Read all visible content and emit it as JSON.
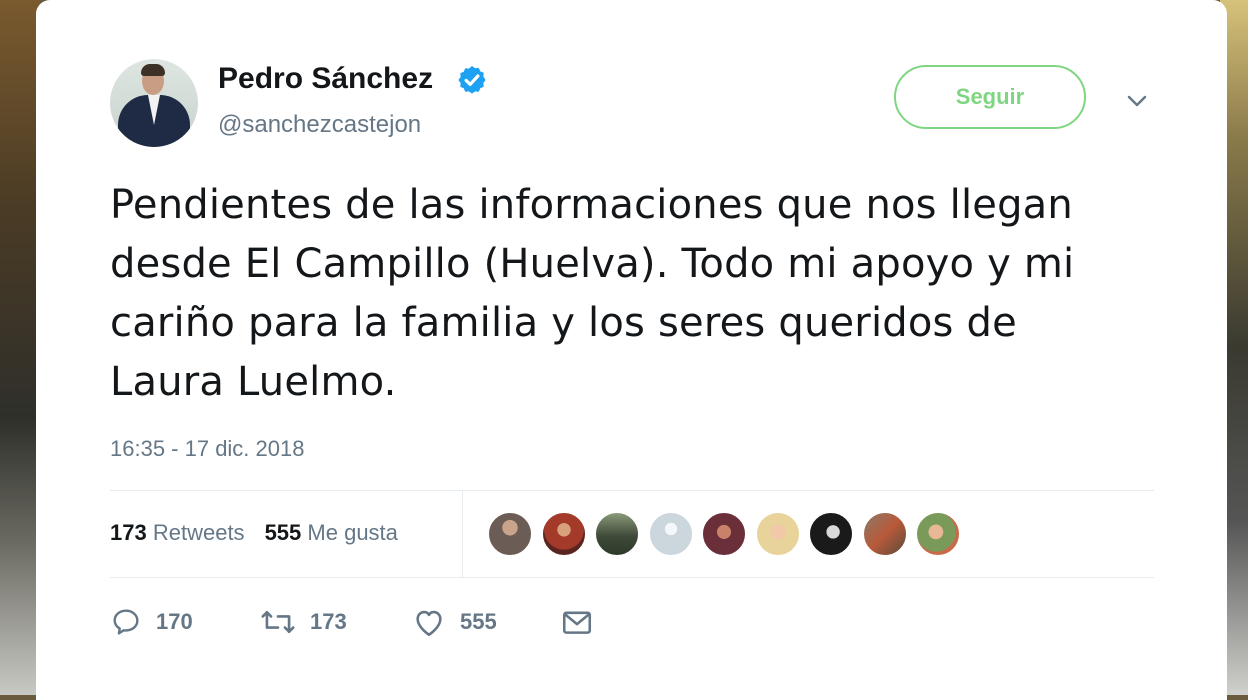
{
  "tweet": {
    "author_name": "Pedro Sánchez",
    "handle": "@sanchezcastejon",
    "verified_icon": "verified-badge-icon",
    "follow_label": "Seguir",
    "text": "Pendientes de las informaciones que nos llegan desde El Campillo (Huelva). Todo mi apoyo y mi cariño para la familia y los seres queridos de Laura Luelmo.",
    "timestamp": "16:35 - 17 dic. 2018"
  },
  "stats": {
    "retweets_count": "173",
    "retweets_label": "Retweets",
    "likes_count": "555",
    "likes_label": "Me gusta"
  },
  "likers_count_shown": 9,
  "actions": {
    "reply_icon": "reply-icon",
    "reply_count": "170",
    "retweet_icon": "retweet-icon",
    "retweet_count": "173",
    "like_icon": "heart-icon",
    "like_count": "555",
    "dm_icon": "envelope-icon"
  },
  "colors": {
    "follow_accent": "#7fd681",
    "verified_blue": "#1da1f2",
    "secondary_text": "#657786",
    "primary_text": "#14171a"
  }
}
